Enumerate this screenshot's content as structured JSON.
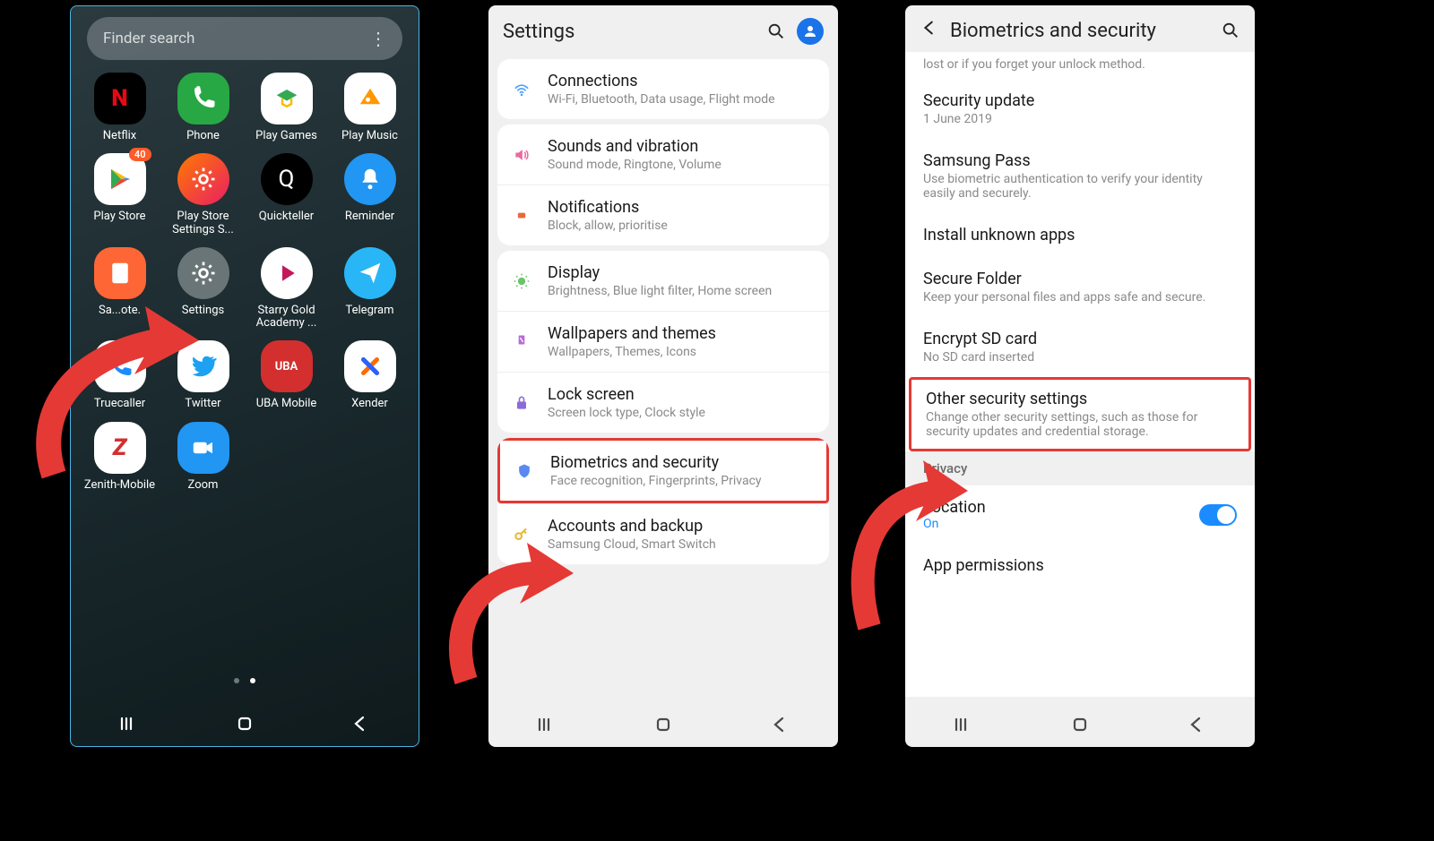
{
  "phone1": {
    "search_placeholder": "Finder search",
    "apps": [
      {
        "label": "Netflix",
        "icon": "N",
        "class": "ic-netflix"
      },
      {
        "label": "Phone",
        "icon": "phone-svg",
        "class": "ic-phone"
      },
      {
        "label": "Play Games",
        "icon": "playgames-svg",
        "class": "ic-playgames"
      },
      {
        "label": "Play Music",
        "icon": "playmusic-svg",
        "class": "ic-playmusic"
      },
      {
        "label": "Play Store",
        "icon": "playstore-svg",
        "class": "ic-playstore",
        "badge": "40"
      },
      {
        "label": "Play Store Settings S...",
        "icon": "gear-svg",
        "class": "ic-pssettings"
      },
      {
        "label": "Quickteller",
        "icon": "Q",
        "class": "ic-quickteller"
      },
      {
        "label": "Reminder",
        "icon": "bell-svg",
        "class": "ic-reminder"
      },
      {
        "label": "Sa...ote.",
        "icon": "note-svg",
        "class": "ic-snotes"
      },
      {
        "label": "Settings",
        "icon": "gear-svg",
        "class": "ic-settings"
      },
      {
        "label": "Starry Gold Academy ...",
        "icon": "play-svg",
        "class": "ic-starry"
      },
      {
        "label": "Telegram",
        "icon": "send-svg",
        "class": "ic-telegram"
      },
      {
        "label": "Truecaller",
        "icon": "phone2-svg",
        "class": "ic-truecaller"
      },
      {
        "label": "Twitter",
        "icon": "twitter-svg",
        "class": "ic-twitter"
      },
      {
        "label": "UBA Mobile",
        "icon": "UBA",
        "class": "ic-uba"
      },
      {
        "label": "Xender",
        "icon": "xender-svg",
        "class": "ic-xender"
      },
      {
        "label": "Zenith-Mobile",
        "icon": "Z",
        "class": "ic-zenith"
      },
      {
        "label": "Zoom",
        "icon": "cam-svg",
        "class": "ic-zoom"
      }
    ]
  },
  "phone2": {
    "title": "Settings",
    "groups": [
      [
        {
          "icon": "wifi",
          "color": "#4aa0ff",
          "title": "Connections",
          "sub": "Wi-Fi, Bluetooth, Data usage, Flight mode"
        }
      ],
      [
        {
          "icon": "sound",
          "color": "#e86aa0",
          "title": "Sounds and vibration",
          "sub": "Sound mode, Ringtone, Volume"
        },
        {
          "icon": "notif",
          "color": "#e86a3a",
          "title": "Notifications",
          "sub": "Block, allow, prioritise"
        }
      ],
      [
        {
          "icon": "display",
          "color": "#6ac46a",
          "title": "Display",
          "sub": "Brightness, Blue light filter, Home screen"
        },
        {
          "icon": "wallpaper",
          "color": "#b86ad8",
          "title": "Wallpapers and themes",
          "sub": "Wallpapers, Themes, Icons"
        },
        {
          "icon": "lock",
          "color": "#8c6ad8",
          "title": "Lock screen",
          "sub": "Screen lock type, Clock style"
        }
      ],
      [
        {
          "icon": "shield",
          "color": "#5a8af0",
          "title": "Biometrics and security",
          "sub": "Face recognition, Fingerprints, Privacy",
          "highlight": true
        },
        {
          "icon": "key",
          "color": "#e8b83a",
          "title": "Accounts and backup",
          "sub": "Samsung Cloud, Smart Switch"
        }
      ]
    ]
  },
  "phone3": {
    "title": "Biometrics and security",
    "top_sub": "lost or if you forget your unlock method.",
    "items": [
      {
        "title": "Security update",
        "sub": "1 June 2019"
      },
      {
        "title": "Samsung Pass",
        "sub": "Use biometric authentication to verify your identity easily and securely."
      },
      {
        "title": "Install unknown apps"
      },
      {
        "title": "Secure Folder",
        "sub": "Keep your personal files and apps safe and secure."
      },
      {
        "title": "Encrypt SD card",
        "sub": "No SD card inserted"
      },
      {
        "title": "Other security settings",
        "sub": "Change other security settings, such as those for security updates and credential storage.",
        "highlight": true
      }
    ],
    "privacy_header": "Privacy",
    "privacy_items": [
      {
        "title": "Location",
        "sub": "On",
        "toggle": true
      },
      {
        "title": "App permissions"
      }
    ]
  }
}
